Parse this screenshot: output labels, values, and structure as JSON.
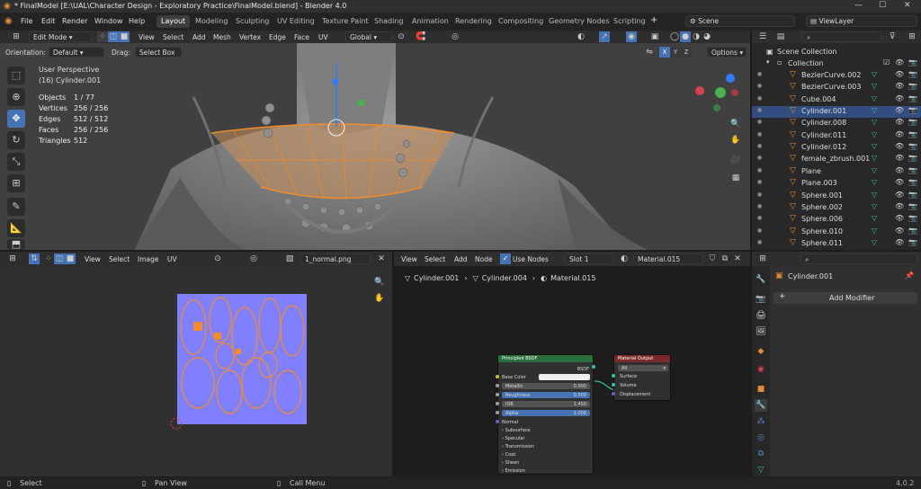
{
  "window": {
    "title": "* FinalModel [E:\\UAL\\Character Design - Exploratory Practice\\FinalModel.blend] - Blender 4.0"
  },
  "menus": [
    "File",
    "Edit",
    "Render",
    "Window",
    "Help"
  ],
  "workspaces": [
    "Layout",
    "Modeling",
    "Sculpting",
    "UV Editing",
    "Texture Paint",
    "Shading",
    "Animation",
    "Rendering",
    "Compositing",
    "Geometry Nodes",
    "Scripting"
  ],
  "active_workspace": "Layout",
  "scene": {
    "name": "Scene",
    "view_layer": "ViewLayer"
  },
  "viewport": {
    "mode": "Edit Mode",
    "menu": [
      "View",
      "Select",
      "Add",
      "Mesh",
      "Vertex",
      "Edge",
      "Face",
      "UV"
    ],
    "transform_orientation": "Global",
    "orientation_label": "Orientation:",
    "orientation_value": "Default",
    "drag_label": "Drag:",
    "drag_value": "Select Box",
    "options_label": "Options",
    "axis_x": "X",
    "axis_y": "Y",
    "axis_z": "Z",
    "overlay_title": "User Perspective",
    "overlay_object": "(16) Cylinder.001",
    "stats": [
      {
        "k": "Objects",
        "v": "1 / 77"
      },
      {
        "k": "Vertices",
        "v": "256 / 256"
      },
      {
        "k": "Edges",
        "v": "512 / 512"
      },
      {
        "k": "Faces",
        "v": "256 / 256"
      },
      {
        "k": "Triangles",
        "v": "512"
      }
    ]
  },
  "outliner": {
    "root": "Scene Collection",
    "collection": "Collection",
    "items": [
      {
        "name": "BezierCurve.002",
        "selected": false
      },
      {
        "name": "BezierCurve.003",
        "selected": false
      },
      {
        "name": "Cube.004",
        "selected": false
      },
      {
        "name": "Cylinder.001",
        "selected": true
      },
      {
        "name": "Cylinder.008",
        "selected": false
      },
      {
        "name": "Cylinder.011",
        "selected": false
      },
      {
        "name": "Cylinder.012",
        "selected": false
      },
      {
        "name": "female_zbrush.001",
        "selected": false
      },
      {
        "name": "Plane",
        "selected": false
      },
      {
        "name": "Plane.003",
        "selected": false
      },
      {
        "name": "Sphere.001",
        "selected": false
      },
      {
        "name": "Sphere.002",
        "selected": false
      },
      {
        "name": "Sphere.006",
        "selected": false
      },
      {
        "name": "Sphere.010",
        "selected": false
      },
      {
        "name": "Sphere.011",
        "selected": false
      }
    ]
  },
  "uv_editor": {
    "menu": [
      "View",
      "Select",
      "Image",
      "UV"
    ],
    "image_name": "1_normal.png"
  },
  "node_editor": {
    "menu": [
      "View",
      "Select",
      "Add",
      "Node"
    ],
    "use_nodes_label": "Use Nodes",
    "slot": "Slot 1",
    "material": "Material.015",
    "breadcrumb": [
      "Cylinder.001",
      "Cylinder.004",
      "Material.015"
    ],
    "bsdf": {
      "title": "Principled BSDF",
      "output": "BSDF",
      "inputs": [
        {
          "label": "Base Color",
          "value": ""
        },
        {
          "label": "Metallic",
          "value": "0.000"
        },
        {
          "label": "Roughness",
          "value": "0.500"
        },
        {
          "label": "IOR",
          "value": "1.450"
        },
        {
          "label": "Alpha",
          "value": "1.000"
        }
      ],
      "normal": "Normal",
      "panels": [
        "Subsurface",
        "Specular",
        "Transmission",
        "Coat",
        "Sheen",
        "Emission"
      ]
    },
    "output": {
      "title": "Material Output",
      "target": "All",
      "sockets": [
        "Surface",
        "Volume",
        "Displacement"
      ]
    }
  },
  "properties": {
    "object": "Cylinder.001",
    "add_modifier": "Add Modifier"
  },
  "statusbar": {
    "select": "Select",
    "pan": "Pan View",
    "call": "Call Menu",
    "version": "4.0.2"
  },
  "colors": {
    "accent": "#4772b3",
    "selection_orange": "#e08c3a",
    "uv_background": "#8080ff",
    "bsdf_header": "#2b6e3a",
    "output_header": "#7a2a2a"
  }
}
